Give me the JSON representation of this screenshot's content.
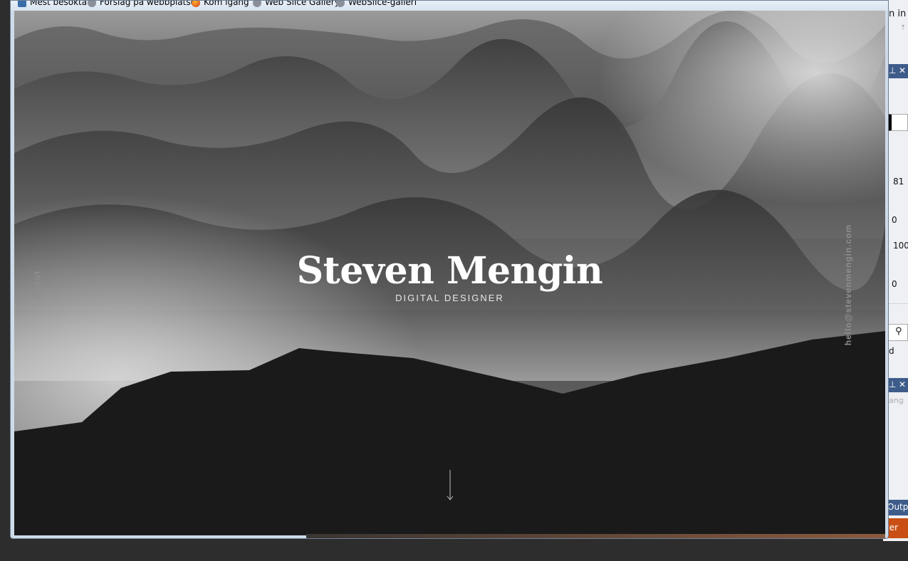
{
  "favorites_bar": {
    "items": [
      {
        "label": "Mest besökta",
        "icon": "favorites-star-icon"
      },
      {
        "label": "Förslag på webbplatser",
        "icon": "globe-icon"
      },
      {
        "label": "Kom igång",
        "icon": "firefox-icon"
      },
      {
        "label": "Web Slice Gallery",
        "icon": "globe-icon"
      },
      {
        "label": "WebSlice-galleri",
        "icon": "globe-icon"
      }
    ]
  },
  "site": {
    "name": "Steven Mengin",
    "tagline": "DIGITAL DESIGNER",
    "about_link": "About",
    "email_link": "hello@stevenmengin.com",
    "scroll_hint_icon": "down-arrow-icon"
  },
  "ide_panel": {
    "title_fragment": "n in",
    "values": [
      "81",
      "0",
      "100",
      "0"
    ],
    "list_fragment": "d",
    "input_fragment": "ang",
    "output_tab": "Outpu",
    "status_fragment": "ter"
  },
  "colors": {
    "page_dark": "#1a1a1a",
    "title": "#ffffff",
    "side_links": "#8e8e8e",
    "ide_header": "#3e5c8a",
    "ide_status": "#c94f14"
  }
}
